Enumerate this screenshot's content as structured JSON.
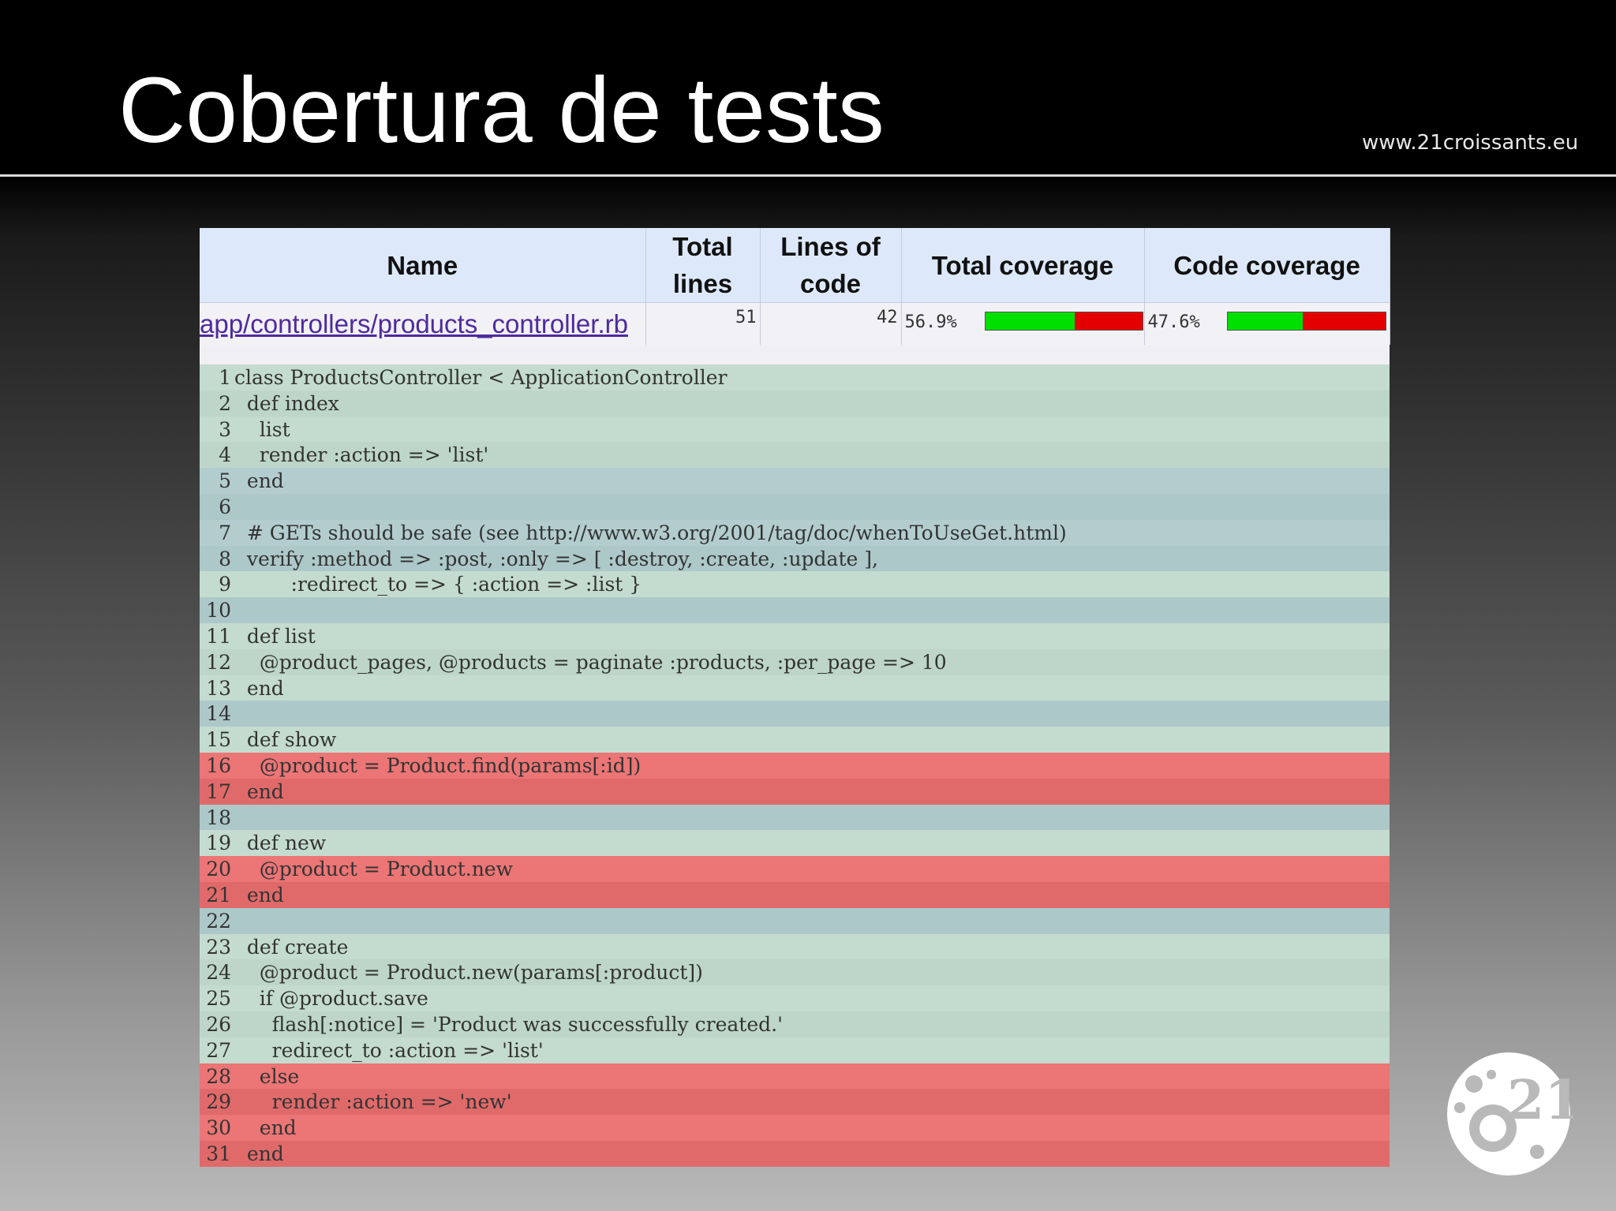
{
  "slide": {
    "title": "Cobertura de tests",
    "site_url": "www.21croissants.eu"
  },
  "summary": {
    "headers": {
      "name": "Name",
      "total_lines": "Total lines",
      "lines_of_code": "Lines of code",
      "total_coverage": "Total coverage",
      "code_coverage": "Code coverage"
    },
    "row": {
      "file": "app/controllers/products_controller.rb",
      "total_lines": "51",
      "lines_of_code": "42",
      "total_coverage": "56.9%",
      "total_coverage_fraction": 0.569,
      "code_coverage": "47.6%",
      "code_coverage_fraction": 0.476
    },
    "colors": {
      "covered": "#00e000",
      "uncovered": "#e50000"
    }
  },
  "code_lines": [
    {
      "n": "1",
      "text": "class ProductsController < ApplicationController",
      "status": "covered"
    },
    {
      "n": "2",
      "text": "  def index",
      "status": "covered"
    },
    {
      "n": "3",
      "text": "    list",
      "status": "covered"
    },
    {
      "n": "4",
      "text": "    render :action => 'list'",
      "status": "covered"
    },
    {
      "n": "5",
      "text": "  end",
      "status": "blank"
    },
    {
      "n": "6",
      "text": "",
      "status": "blank"
    },
    {
      "n": "7",
      "text": "  # GETs should be safe (see http://www.w3.org/2001/tag/doc/whenToUseGet.html)",
      "status": "blank"
    },
    {
      "n": "8",
      "text": "  verify :method => :post, :only => [ :destroy, :create, :update ],",
      "status": "blank"
    },
    {
      "n": "9",
      "text": "         :redirect_to => { :action => :list }",
      "status": "covered"
    },
    {
      "n": "10",
      "text": "",
      "status": "blank"
    },
    {
      "n": "11",
      "text": "  def list",
      "status": "covered"
    },
    {
      "n": "12",
      "text": "    @product_pages, @products = paginate :products, :per_page => 10",
      "status": "covered"
    },
    {
      "n": "13",
      "text": "  end",
      "status": "covered"
    },
    {
      "n": "14",
      "text": "",
      "status": "blank"
    },
    {
      "n": "15",
      "text": "  def show",
      "status": "covered"
    },
    {
      "n": "16",
      "text": "    @product = Product.find(params[:id])",
      "status": "missed"
    },
    {
      "n": "17",
      "text": "  end",
      "status": "missed"
    },
    {
      "n": "18",
      "text": "",
      "status": "blank"
    },
    {
      "n": "19",
      "text": "  def new",
      "status": "covered"
    },
    {
      "n": "20",
      "text": "    @product = Product.new",
      "status": "missed"
    },
    {
      "n": "21",
      "text": "  end",
      "status": "missed"
    },
    {
      "n": "22",
      "text": "",
      "status": "blank"
    },
    {
      "n": "23",
      "text": "  def create",
      "status": "covered"
    },
    {
      "n": "24",
      "text": "    @product = Product.new(params[:product])",
      "status": "covered"
    },
    {
      "n": "25",
      "text": "    if @product.save",
      "status": "covered"
    },
    {
      "n": "26",
      "text": "      flash[:notice] = 'Product was successfully created.'",
      "status": "covered"
    },
    {
      "n": "27",
      "text": "      redirect_to :action => 'list'",
      "status": "covered"
    },
    {
      "n": "28",
      "text": "    else",
      "status": "missed"
    },
    {
      "n": "29",
      "text": "      render :action => 'new'",
      "status": "missed"
    },
    {
      "n": "30",
      "text": "    end",
      "status": "missed"
    },
    {
      "n": "31",
      "text": "  end",
      "status": "missed"
    }
  ],
  "logo": {
    "icon": "21croissants-logo"
  }
}
